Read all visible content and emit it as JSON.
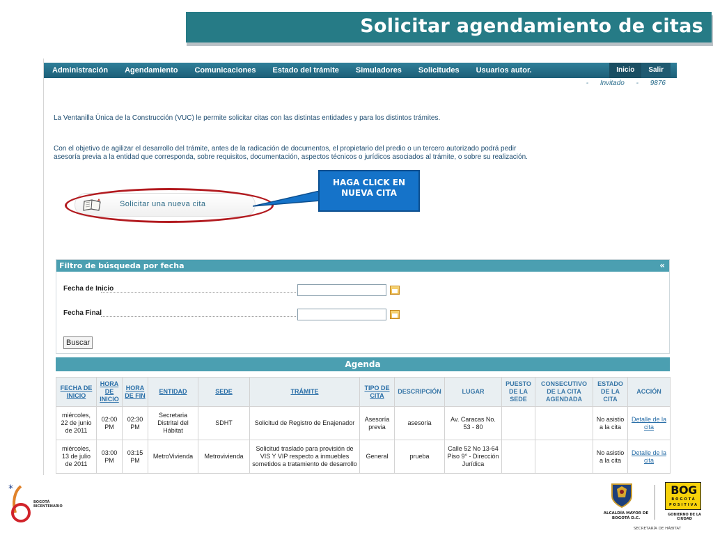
{
  "slide": {
    "title": "Solicitar agendamiento de citas"
  },
  "nav": {
    "items": [
      "Administración",
      "Agendamiento",
      "Comunicaciones",
      "Estado del trámite",
      "Simuladores",
      "Solicitudes",
      "Usuarios autor."
    ],
    "inicio": "Inicio",
    "salir": "Salir"
  },
  "user": {
    "sep1": "-",
    "name": "Invitado",
    "sep2": "-",
    "code": "9876"
  },
  "intro": {
    "p1": "La Ventanilla Única de la Construcción (VUC) le permite solicitar citas con las distintas entidades y para los distintos trámites.",
    "p2": "Con el objetivo de agilizar el desarrollo del trámite, antes de la radicación de documentos, el propietario del predio o un tercero autorizado podrá pedir asesoría previa a la entidad que corresponda, sobre requisitos, documentación, aspectos técnicos o jurídicos asociados al trámite, o sobre su realización."
  },
  "new_appointment": {
    "label": "Solicitar una nueva cita",
    "icon": "book-icon"
  },
  "callout": {
    "text": "HAGA CLICK EN NUEVA CITA"
  },
  "filter": {
    "title": "Filtro de búsqueda por fecha",
    "collapse": "«",
    "start_label": "Fecha de Inicio",
    "start_value": "",
    "end_label": "Fecha Final",
    "end_value": "",
    "search": "Buscar"
  },
  "agenda": {
    "title": "Agenda",
    "headers": [
      "FECHA DE INICIO",
      "HORA DE INICIO",
      "HORA DE FIN",
      "ENTIDAD",
      "SEDE",
      "TRÁMITE",
      "TIPO DE CITA",
      "DESCRIPCIÓN",
      "LUGAR",
      "PUESTO DE LA SEDE",
      "CONSECUTIVO DE LA CITA AGENDADA",
      "ESTADO DE LA CITA",
      "ACCIÓN"
    ],
    "rows": [
      [
        "miércoles, 22 de junio de 2011",
        "02:00 PM",
        "02:30 PM",
        "Secretaria Distrital del Hábitat",
        "SDHT",
        "Solicitud de Registro de Enajenador",
        "Asesoría previa",
        "asesoria",
        "Av. Caracas No. 53 - 80",
        "",
        "",
        "No asistio a la cita",
        "Detalle de la cita"
      ],
      [
        "miércoles, 13 de julio de 2011",
        "03:00 PM",
        "03:15 PM",
        "MetroVivienda",
        "Metrovivienda",
        "Solicitud traslado para provisión de VIS Y VIP respecto a inmuebles sometidos a tratamiento de desarrollo",
        "General",
        "prueba",
        "Calle 52 No 13-64 Piso 9° - Dirección Jurídica",
        "",
        "",
        "No asistio a la cita",
        "Detalle de la cita"
      ]
    ]
  },
  "footer": {
    "bicentenario": "BOGOTÁ BICENTENARIO",
    "alcaldia": "ALCALDÍA MAYOR DE BOGOTÁ D.C.",
    "bog_big": "BOG",
    "bog_line1": "BOGOTÁ",
    "bog_line2": "POSITIVA",
    "gobierno": "GOBIERNO DE LA CIUDAD",
    "secretaria": "SECRETARÍA DE HÁBITAT"
  },
  "colors": {
    "banner": "#267b86",
    "nav": "#1c5e77",
    "panel_head": "#4b9fb1",
    "callout": "#1573c9",
    "highlight_ellipse": "#b21a1f"
  }
}
